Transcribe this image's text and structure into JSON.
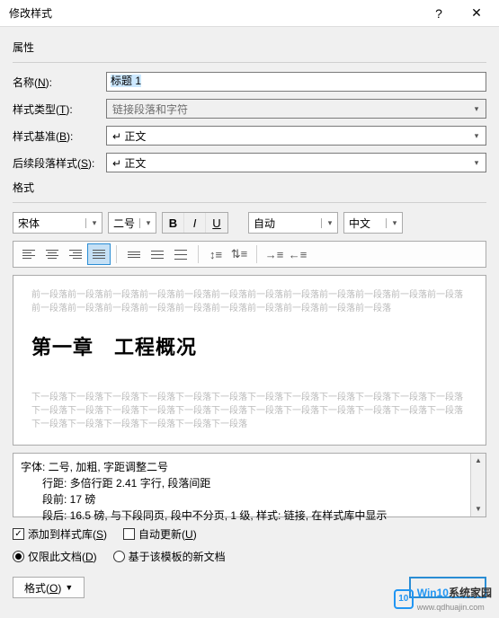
{
  "title": "修改样式",
  "help_symbol": "?",
  "close_symbol": "✕",
  "sections": {
    "properties": "属性",
    "format": "格式"
  },
  "labels": {
    "name": "名称(N):",
    "style_type": "样式类型(T):",
    "style_based": "样式基准(B):",
    "following": "后续段落样式(S):"
  },
  "values": {
    "name": "标题 1",
    "style_type": "链接段落和字符",
    "style_based": "↵ 正文",
    "following": "↵ 正文",
    "font": "宋体",
    "size": "二号",
    "auto": "自动",
    "lang": "中文"
  },
  "fmt_buttons": {
    "bold": "B",
    "italic": "I",
    "underline": "U"
  },
  "preview": {
    "gray_prev_unit": "前一段落",
    "heading": "第一章　工程概况",
    "gray_next_unit": "下一段落"
  },
  "description": {
    "line1": "字体: 二号, 加粗, 字距调整二号",
    "line2": "行距: 多倍行距 2.41 字行, 段落间距",
    "line3": "段前: 17 磅",
    "line4": "段后: 16.5 磅, 与下段同页, 段中不分页, 1 级, 样式: 链接, 在样式库中显示"
  },
  "checkboxes": {
    "add_to_gallery": "添加到样式库(S)",
    "auto_update": "自动更新(U)"
  },
  "radios": {
    "this_doc": "仅限此文档(D)",
    "template": "基于该模板的新文档"
  },
  "format_button": "格式(O)",
  "watermark": {
    "logo": "10",
    "brand1": "Win10",
    "brand2": "系统家园",
    "url": "www.qdhuajin.com"
  }
}
